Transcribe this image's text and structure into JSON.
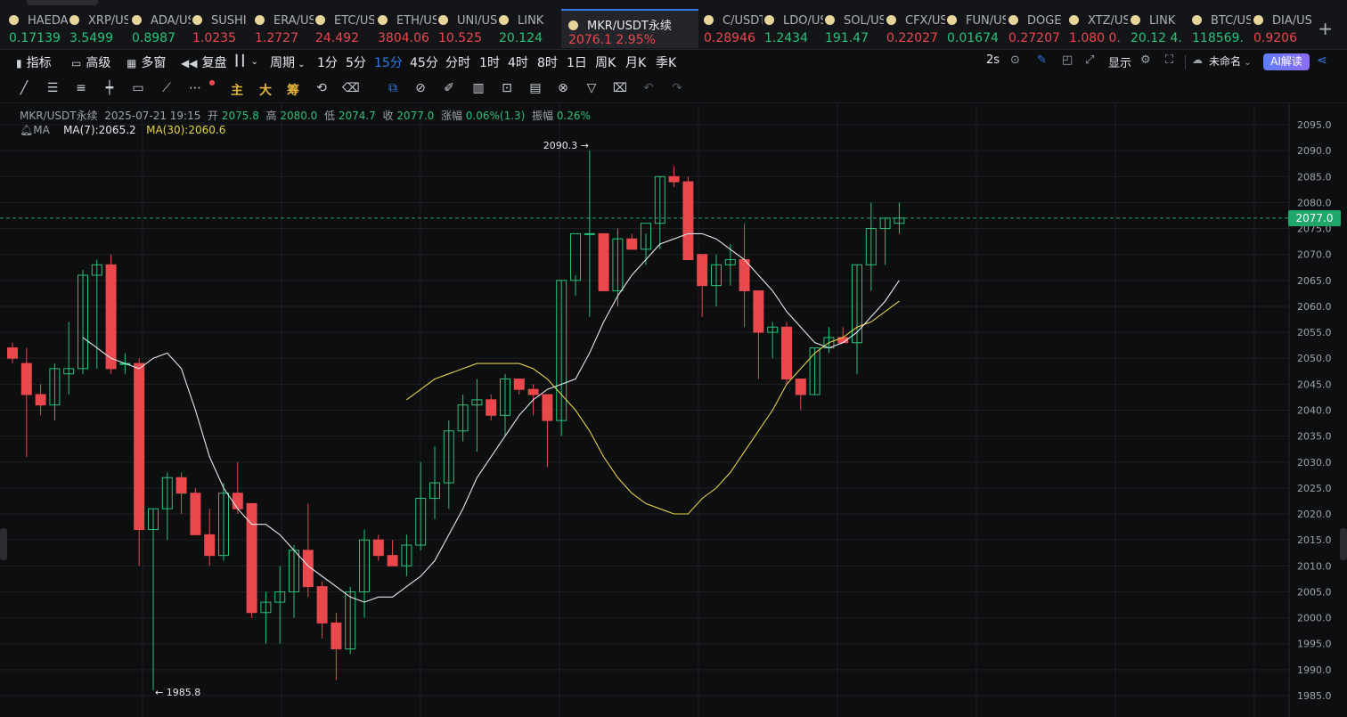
{
  "ticker": [
    {
      "sym": "HAEDAL",
      "price": "0.17139",
      "dir": "up"
    },
    {
      "sym": "XRP/USDT",
      "price": "3.5499",
      "dir": "up"
    },
    {
      "sym": "ADA/USDT",
      "price": "0.8987",
      "dir": "up"
    },
    {
      "sym": "SUSHI",
      "price": "1.0235",
      "dir": "dn"
    },
    {
      "sym": "ERA/USDT",
      "price": "1.2727",
      "dir": "dn"
    },
    {
      "sym": "ETC/USDT",
      "price": "24.492",
      "dir": "dn"
    },
    {
      "sym": "ETH/USDT",
      "price": "3804.06",
      "dir": "dn"
    },
    {
      "sym": "UNI/USDT",
      "price": "10.525",
      "dir": "dn"
    },
    {
      "sym": "LINK",
      "price": "20.124",
      "dir": "up"
    },
    {
      "sym": "MKR/USDT永续",
      "price": "2076.1  2.95%",
      "dir": "dn",
      "active": true
    },
    {
      "sym": "C/USDT",
      "price": "0.28946",
      "dir": "dn"
    },
    {
      "sym": "LDO/USDT",
      "price": "1.2434",
      "dir": "up"
    },
    {
      "sym": "SOL/USDT",
      "price": "191.47",
      "dir": "up"
    },
    {
      "sym": "CFX/USDT",
      "price": "0.22027",
      "dir": "dn"
    },
    {
      "sym": "FUN/USDT",
      "price": "0.01674",
      "dir": "up"
    },
    {
      "sym": "DOGE",
      "price": "0.27207",
      "dir": "dn"
    },
    {
      "sym": "XTZ/USDT",
      "price": "1.080  0.",
      "dir": "dn"
    },
    {
      "sym": "LINK",
      "price": "20.12  4.",
      "dir": "up"
    },
    {
      "sym": "BTC/USDT",
      "price": "118569.",
      "dir": "up"
    },
    {
      "sym": "DIA/USDT",
      "price": "0.9206",
      "dir": "dn"
    }
  ],
  "toolbar": {
    "indicators": "指标",
    "advanced": "高级",
    "multi_window": "多窗",
    "replay": "复盘",
    "period": "周期",
    "intervals": [
      "1分",
      "5分",
      "15分",
      "45分",
      "分时",
      "1时",
      "4时",
      "8时",
      "1日",
      "周K",
      "月K",
      "季K"
    ],
    "selected_interval": "15分",
    "refresh": "2s",
    "display": "显示",
    "layout_name": "未命名",
    "ai": "AI解读"
  },
  "drawtools": {
    "main": "主",
    "large": "大",
    "chips": "筹"
  },
  "info": {
    "symbol": "MKR/USDT永续",
    "datetime": "2025-07-21 19:15",
    "open_label": "开",
    "open": "2075.8",
    "high_label": "高",
    "high": "2080.0",
    "low_label": "低",
    "low": "2074.7",
    "close_label": "收",
    "close": "2077.0",
    "chg_label": "涨幅",
    "chg": "0.06%(1.3)",
    "amp_label": "振幅",
    "amp": "0.26%",
    "ma_label": "MA",
    "ma7": "MA(7):2065.2",
    "ma30": "MA(30):2060.6"
  },
  "price_tag": "2077.0",
  "hi_label": "2090.3 →",
  "lo_label": "← 1985.8",
  "colors": {
    "up": "#27c27a",
    "down": "#e9484d",
    "ma7": "#e6e8eb",
    "ma30": "#e4d34a",
    "accent": "#2e7be5"
  },
  "chart_data": {
    "type": "candlestick",
    "ylim": [
      1983,
      2098
    ],
    "y_ticks": [
      1985,
      1990,
      1995,
      2000,
      2005,
      2010,
      2015,
      2020,
      2025,
      2030,
      2035,
      2040,
      2045,
      2050,
      2055,
      2060,
      2065,
      2070,
      2075,
      2080,
      2085,
      2090,
      2095
    ],
    "last_price": 2077.0,
    "candles": [
      [
        2052,
        2053,
        2049,
        2050
      ],
      [
        2049,
        2052,
        2031,
        2043
      ],
      [
        2043,
        2045,
        2039,
        2041
      ],
      [
        2041,
        2049,
        2038,
        2048
      ],
      [
        2047,
        2057,
        2043,
        2048
      ],
      [
        2048,
        2067,
        2047,
        2066
      ],
      [
        2066,
        2069,
        2048,
        2068
      ],
      [
        2068,
        2070,
        2047,
        2048
      ],
      [
        2049,
        2051,
        2047,
        2049
      ],
      [
        2049,
        2050,
        2010,
        2017
      ],
      [
        2017,
        2021,
        1986,
        2021
      ],
      [
        2021,
        2028,
        2015,
        2027
      ],
      [
        2027,
        2028,
        2020,
        2024
      ],
      [
        2024,
        2025,
        2016,
        2016
      ],
      [
        2016,
        2021,
        2010,
        2012
      ],
      [
        2012,
        2026,
        2011,
        2024
      ],
      [
        2024,
        2030,
        2020,
        2021
      ],
      [
        2022,
        2022,
        2000,
        2001
      ],
      [
        2001,
        2005,
        1995,
        2003
      ],
      [
        2003,
        2010,
        1995,
        2005
      ],
      [
        2005,
        2014,
        2000,
        2013
      ],
      [
        2013,
        2022,
        2004,
        2006
      ],
      [
        2006,
        2007,
        1996,
        1999
      ],
      [
        1999,
        2001,
        1988,
        1994
      ],
      [
        1994,
        2006,
        1993,
        2005
      ],
      [
        2005,
        2017,
        2000,
        2015
      ],
      [
        2015,
        2016,
        2011,
        2012
      ],
      [
        2012,
        2015,
        2010,
        2010
      ],
      [
        2010,
        2016,
        2008,
        2014
      ],
      [
        2014,
        2030,
        2013,
        2023
      ],
      [
        2023,
        2033,
        2019,
        2026
      ],
      [
        2026,
        2038,
        2021,
        2036
      ],
      [
        2036,
        2043,
        2034,
        2041
      ],
      [
        2041,
        2046,
        2032,
        2042
      ],
      [
        2042,
        2043,
        2038,
        2039
      ],
      [
        2039,
        2047,
        2035,
        2046
      ],
      [
        2046,
        2046,
        2043,
        2044
      ],
      [
        2044,
        2045,
        2039,
        2043
      ],
      [
        2043,
        2043,
        2029,
        2038
      ],
      [
        2038,
        2065,
        2035,
        2065
      ],
      [
        2065,
        2066,
        2062,
        2074
      ],
      [
        2074,
        2090,
        2058,
        2074
      ],
      [
        2074,
        2074,
        2063,
        2063
      ],
      [
        2063,
        2075,
        2060,
        2073
      ],
      [
        2073,
        2074,
        2072,
        2071
      ],
      [
        2071,
        2074,
        2068,
        2076
      ],
      [
        2076,
        2085,
        2071,
        2085
      ],
      [
        2085,
        2087,
        2083,
        2084
      ],
      [
        2084,
        2085,
        2070,
        2069
      ],
      [
        2070,
        2070,
        2058,
        2064
      ],
      [
        2064,
        2070,
        2060,
        2068
      ],
      [
        2068,
        2072,
        2064,
        2069
      ],
      [
        2069,
        2076,
        2056,
        2063
      ],
      [
        2063,
        2063,
        2046,
        2055
      ],
      [
        2055,
        2057,
        2050,
        2056
      ],
      [
        2056,
        2057,
        2045,
        2046
      ],
      [
        2046,
        2046,
        2040,
        2043
      ],
      [
        2043,
        2052,
        2043,
        2052
      ],
      [
        2052,
        2056,
        2051,
        2054
      ],
      [
        2054,
        2056,
        2053,
        2053
      ],
      [
        2053,
        2068,
        2047,
        2068
      ],
      [
        2068,
        2080,
        2063,
        2075
      ],
      [
        2075,
        2077,
        2068,
        2077
      ],
      [
        2076,
        2080,
        2074,
        2077
      ]
    ],
    "ma7": [
      2054,
      2052,
      2050,
      2049,
      2048,
      2050,
      2051,
      2048,
      2040,
      2031,
      2025,
      2021,
      2018,
      2018,
      2016,
      2013,
      2010,
      2008,
      2006,
      2004,
      2003,
      2004,
      2004,
      2006,
      2008,
      2011,
      2016,
      2021,
      2027,
      2031,
      2035,
      2039,
      2042,
      2044,
      2045,
      2046,
      2051,
      2057,
      2062,
      2066,
      2069,
      2072,
      2073,
      2074,
      2074,
      2073,
      2071,
      2069,
      2066,
      2063,
      2059,
      2056,
      2053,
      2052,
      2053,
      2055,
      2058,
      2061,
      2065
    ],
    "ma30": [
      2042,
      2044,
      2046,
      2047,
      2048,
      2049,
      2049,
      2049,
      2049,
      2048,
      2046,
      2043,
      2040,
      2036,
      2031,
      2027,
      2024,
      2022,
      2021,
      2020,
      2020,
      2023,
      2025,
      2028,
      2032,
      2036,
      2040,
      2045,
      2048,
      2051,
      2053,
      2054,
      2056,
      2057,
      2059,
      2061
    ]
  }
}
